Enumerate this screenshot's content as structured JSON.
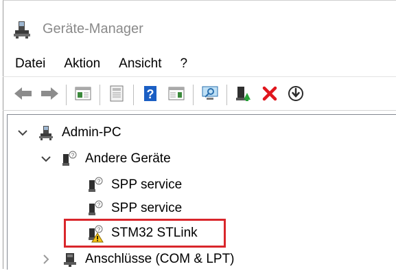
{
  "window": {
    "title": "Geräte-Manager",
    "app_icon": "device-manager-icon"
  },
  "menubar": {
    "items": [
      {
        "label": "Datei"
      },
      {
        "label": "Aktion"
      },
      {
        "label": "Ansicht"
      },
      {
        "label": "?"
      }
    ]
  },
  "toolbar": {
    "buttons": [
      {
        "icon": "back-arrow-icon"
      },
      {
        "icon": "forward-arrow-icon"
      },
      {
        "icon": "show-hide-console-tree-icon"
      },
      {
        "icon": "properties-icon"
      },
      {
        "icon": "help-icon"
      },
      {
        "icon": "action-pane-icon"
      },
      {
        "icon": "scan-hardware-changes-icon"
      },
      {
        "icon": "update-driver-icon"
      },
      {
        "icon": "uninstall-device-icon"
      },
      {
        "icon": "disable-device-icon"
      }
    ],
    "colors": {
      "uninstall": "#e0161d",
      "help": "#1b5fc4"
    }
  },
  "tree": {
    "root": {
      "label": "Admin-PC",
      "expanded": true
    },
    "other_devices": {
      "label": "Andere Geräte",
      "expanded": true
    },
    "children": [
      {
        "label": "SPP service",
        "warning": false
      },
      {
        "label": "SPP service",
        "warning": false
      },
      {
        "label": "STM32 STLink",
        "warning": true,
        "highlighted": true
      }
    ],
    "ports": {
      "label": "Anschlüsse (COM & LPT)",
      "expanded": false
    }
  },
  "highlight_color": "#d9262b"
}
